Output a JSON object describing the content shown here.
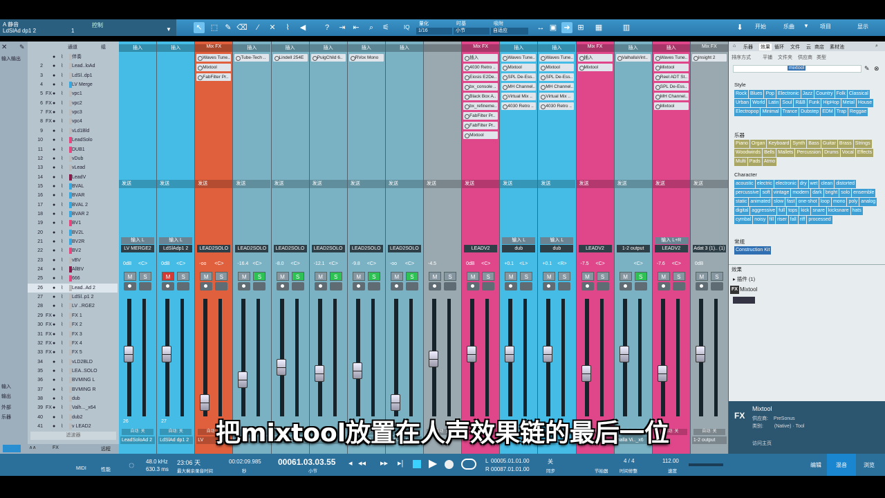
{
  "topbar": {
    "song_label": "静音",
    "track_name": "LdSlAd dp1 2",
    "ctrl_label": "控制",
    "icon_a": "A",
    "counter": "1",
    "quant_label": "量化",
    "quant_value": "1/16",
    "timebase_label": "时基",
    "timebase_value": "小节",
    "snap_label": "吸附",
    "snap_value": "自适应",
    "iq": "IQ",
    "nav": [
      "开始",
      "乐曲",
      "项目",
      "显示"
    ]
  },
  "tracklist": {
    "header_ch": "通道",
    "header_grp": "组",
    "input_menu": "输入输出",
    "side_labels": [
      "输入",
      "输出",
      "外部",
      "乐器"
    ],
    "rows": [
      {
        "n": "",
        "f": "",
        "nm": "伴奏",
        "c": "#bbb"
      },
      {
        "n": "2",
        "f": "",
        "nm": "Lead..loAd",
        "c": "#bbb"
      },
      {
        "n": "3",
        "f": "",
        "nm": "LdSl..dp1",
        "c": "#bbb"
      },
      {
        "n": "4",
        "f": "",
        "nm": "LV Merge",
        "c": "#35a9e0"
      },
      {
        "n": "5",
        "f": "FX",
        "nm": "vpc1",
        "c": "#bbb"
      },
      {
        "n": "6",
        "f": "FX",
        "nm": "vpc2",
        "c": "#bbb"
      },
      {
        "n": "7",
        "f": "FX",
        "nm": "vpc3",
        "c": "#bbb"
      },
      {
        "n": "8",
        "f": "FX",
        "nm": "vpc4",
        "c": "#bbb"
      },
      {
        "n": "9",
        "f": "",
        "nm": "vLd1Bld",
        "c": "#bbb"
      },
      {
        "n": "10",
        "f": "",
        "nm": "LeadSolo",
        "c": "#e8467e"
      },
      {
        "n": "11",
        "f": "",
        "nm": "DUB1",
        "c": "#e8467e"
      },
      {
        "n": "12",
        "f": "",
        "nm": "vDub",
        "c": "#bbb"
      },
      {
        "n": "13",
        "f": "",
        "nm": "vLead",
        "c": "#bbb"
      },
      {
        "n": "14",
        "f": "",
        "nm": "LeadV",
        "c": "#8a1a4a"
      },
      {
        "n": "15",
        "f": "",
        "nm": "BVAL",
        "c": "#35a9e0"
      },
      {
        "n": "16",
        "f": "",
        "nm": "BVAR",
        "c": "#35a9e0"
      },
      {
        "n": "17",
        "f": "",
        "nm": "BVAL 2",
        "c": "#35a9e0"
      },
      {
        "n": "18",
        "f": "",
        "nm": "BVAR 2",
        "c": "#35a9e0"
      },
      {
        "n": "19",
        "f": "",
        "nm": "BV1",
        "c": "#e8467e"
      },
      {
        "n": "20",
        "f": "",
        "nm": "BV2L",
        "c": "#35a9e0"
      },
      {
        "n": "21",
        "f": "",
        "nm": "BV2R",
        "c": "#35a9e0"
      },
      {
        "n": "22",
        "f": "",
        "nm": "BV2",
        "c": "#e8467e"
      },
      {
        "n": "23",
        "f": "",
        "nm": "vBV",
        "c": "#bbb"
      },
      {
        "n": "24",
        "f": "",
        "nm": "AllBV",
        "c": "#8a1a4a"
      },
      {
        "n": "25",
        "f": "",
        "nm": "666",
        "c": "#e8467e"
      },
      {
        "n": "26",
        "f": "",
        "nm": "Lead..Ad 2",
        "c": "#bbb"
      },
      {
        "n": "27",
        "f": "",
        "nm": "LdSl..p1 2",
        "c": "#bbb"
      },
      {
        "n": "28",
        "f": "",
        "nm": "LV ..RGE2",
        "c": "#bbb"
      },
      {
        "n": "29",
        "f": "FX",
        "nm": "FX 1",
        "c": "#bbb"
      },
      {
        "n": "30",
        "f": "FX",
        "nm": "FX 2",
        "c": "#bbb"
      },
      {
        "n": "31",
        "f": "FX",
        "nm": "FX 3",
        "c": "#bbb"
      },
      {
        "n": "32",
        "f": "FX",
        "nm": "FX 4",
        "c": "#bbb"
      },
      {
        "n": "33",
        "f": "FX",
        "nm": "FX 5",
        "c": "#bbb"
      },
      {
        "n": "34",
        "f": "",
        "nm": "vLD2BLD",
        "c": "#bbb"
      },
      {
        "n": "35",
        "f": "",
        "nm": "LEA..SOLO",
        "c": "#bbb"
      },
      {
        "n": "36",
        "f": "",
        "nm": "BVMING L",
        "c": "#bbb"
      },
      {
        "n": "37",
        "f": "",
        "nm": "BVMING R",
        "c": "#bbb"
      },
      {
        "n": "38",
        "f": "",
        "nm": "dub",
        "c": "#bbb"
      },
      {
        "n": "39",
        "f": "FX",
        "nm": "Valh..._x64",
        "c": "#bbb"
      },
      {
        "n": "40",
        "f": "",
        "nm": "dub2",
        "c": "#bbb"
      },
      {
        "n": "41",
        "f": "",
        "nm": "v LEAD2",
        "c": "#bbb"
      }
    ],
    "filter_label": "滤波器"
  },
  "mixer": {
    "insert_label": "插入",
    "send_label": "发送",
    "auto_label": "自动: 关",
    "strips": [
      {
        "hdr": "插入",
        "bg": "#44bce6",
        "ins": [],
        "inp": "输入 L",
        "ch": "LV MERGE2",
        "vol": "0dB",
        "pan": "<C>",
        "solo": false,
        "mute": false,
        "num": "26",
        "bottom": "LeadSoloAd 2",
        "fader": 0.55
      },
      {
        "hdr": "插入",
        "bg": "#44bce6",
        "ins": [],
        "inp": "输入 L",
        "ch": "LdSlAdp1 2",
        "vol": "0dB",
        "pan": "<C>",
        "solo": false,
        "mute": true,
        "num": "27",
        "bottom": "LdSlAd dp1 2",
        "fader": 0.55
      },
      {
        "hdr": "Mix FX",
        "bg": "#e0603d",
        "ins": [
          "Waves Tune..",
          "Mixtool",
          "FabFilter Pr.."
        ],
        "inp": "",
        "ch": "LEAD2SOLO",
        "vol": "-oo",
        "pan": "<C>",
        "solo": false,
        "mute": false,
        "num": "",
        "bottom": "LV",
        "fader": 0.08
      },
      {
        "hdr": "插入",
        "bg": "#7ab2c4",
        "ins": [
          "Tube-Tech .."
        ],
        "inp": "",
        "ch": "LEAD2SOLO",
        "vol": "-16.4",
        "pan": "<C>",
        "solo": true,
        "mute": false,
        "num": "",
        "bottom": "vLD2BLD",
        "fader": 0.3
      },
      {
        "hdr": "插入",
        "bg": "#7ab2c4",
        "ins": [
          "Lindell 254E"
        ],
        "inp": "",
        "ch": "LEAD2SOLO",
        "vol": "-8.0",
        "pan": "<C>",
        "solo": true,
        "mute": false,
        "num": "",
        "bottom": "vLD2BLD",
        "fader": 0.42
      },
      {
        "hdr": "插入",
        "bg": "#7ab2c4",
        "ins": [
          "PuigChild 6.."
        ],
        "inp": "",
        "ch": "LEAD2SOLO",
        "vol": "-12.1",
        "pan": "<C>",
        "solo": true,
        "mute": false,
        "num": "",
        "bottom": "vLD2BLD",
        "fader": 0.36
      },
      {
        "hdr": "插入",
        "bg": "#7ab2c4",
        "ins": [
          "RVox Mono"
        ],
        "inp": "",
        "ch": "LEAD2SOLO",
        "vol": "-9.8",
        "pan": "<C>",
        "solo": true,
        "mute": false,
        "num": "",
        "bottom": "vLD2BLD",
        "fader": 0.39
      },
      {
        "hdr": "插入",
        "bg": "#7ab2c4",
        "ins": [],
        "inp": "",
        "ch": "LEAD2SOLO",
        "vol": "-oo",
        "pan": "<C>",
        "solo": true,
        "mute": false,
        "num": "",
        "bottom": "vLD2BLD",
        "fader": 0.08
      },
      {
        "hdr": "",
        "bg": "#9aa8b0",
        "ins": [],
        "inp": "",
        "ch": "",
        "vol": "-4.5",
        "pan": "",
        "solo": false,
        "mute": false,
        "num": "",
        "bottom": "",
        "fader": 0.5
      },
      {
        "hdr": "Mix FX",
        "bg": "#e0478a",
        "ins": [
          "插入",
          "4030 Retro ..",
          "Eiosis E2De..",
          "bx_console ..",
          "Black Box A..",
          "bx_refineme..",
          "FabFilter Pr..",
          "FabFilter Pr..",
          "Mixtool"
        ],
        "inp": "",
        "ch": "LEADV2",
        "vol": "0dB",
        "pan": "<C>",
        "solo": false,
        "mute": false,
        "num": "",
        "bottom": "",
        "fader": 0.55
      },
      {
        "hdr": "插入",
        "bg": "#44bce6",
        "ins": [
          "Waves Tune..",
          "Mixtool",
          "SPL De-Ess..",
          "MH Channel..",
          "Virtual Mix ..",
          "4030 Retro .."
        ],
        "inp": "输入 L",
        "ch": "dub",
        "vol": "+0.1",
        "pan": "<L>",
        "solo": false,
        "mute": false,
        "num": "",
        "bottom": "",
        "fader": 0.55
      },
      {
        "hdr": "插入",
        "bg": "#44bce6",
        "ins": [
          "Waves Tune..",
          "Mixtool",
          "SPL De-Ess..",
          "MH Channel..",
          "Virtual Mix ..",
          "4030 Retro .."
        ],
        "inp": "输入 L",
        "ch": "dub",
        "vol": "+0.1",
        "pan": "<R>",
        "solo": false,
        "mute": false,
        "num": "",
        "bottom": "",
        "fader": 0.55
      },
      {
        "hdr": "Mix FX",
        "bg": "#e0478a",
        "ins": [
          "插入",
          "Mixtool"
        ],
        "inp": "",
        "ch": "LEADV2",
        "vol": "-7.5",
        "pan": "<C>",
        "solo": false,
        "mute": false,
        "num": "",
        "bottom": "",
        "fader": 0.36
      },
      {
        "hdr": "插入",
        "bg": "#7ab2c4",
        "ins": [
          "ValhallaVint.."
        ],
        "inp": "",
        "ch": "1-2 output",
        "vol": "",
        "pan": "<C>",
        "solo": true,
        "mute": false,
        "num": "",
        "bottom": "halla Vi.._x6",
        "fader": 0.55
      },
      {
        "hdr": "插入",
        "bg": "#e0478a",
        "ins": [
          "Waves Tune..",
          "Mixtool",
          "Reel ADT St..",
          "SPL De-Ess..",
          "MH Channel..",
          "Mixtool"
        ],
        "inp": "输入 L+R",
        "ch": "LEADV2",
        "vol": "-7.6",
        "pan": "<C>",
        "solo": false,
        "mute": false,
        "num": "",
        "bottom": "",
        "fader": 0.36
      },
      {
        "hdr": "Mix FX",
        "bg": "#9aa8b0",
        "ins": [
          "Insight 2"
        ],
        "inp": "",
        "ch": "Adat 3 (1).. (1)",
        "vol": "0dB",
        "pan": "",
        "solo": false,
        "mute": false,
        "num": "",
        "bottom": "1-2 output",
        "fader": 0.55
      }
    ]
  },
  "browser": {
    "tabs": [
      "乐器",
      "效果",
      "循环",
      "文件",
      "云",
      "商店",
      "素材池"
    ],
    "sort_label": "排序方式",
    "sort_opts": [
      "平铺",
      "文件夹",
      "供应商",
      "类型"
    ],
    "search": "mixtool",
    "style_label": "Style",
    "style_tags": [
      "Rock",
      "Blues",
      "Pop",
      "Electronic",
      "Jazz",
      "Country",
      "Folk",
      "Classical",
      "Urban",
      "World",
      "Latin",
      "Soul",
      "R&B",
      "Funk",
      "HipHop",
      "Metal",
      "House",
      "Electropop",
      "Minimal",
      "Trance",
      "Dubstep",
      "EDM",
      "Trap",
      "Reggae"
    ],
    "inst_label": "乐器",
    "inst_tags": [
      "Piano",
      "Organ",
      "Keyboard",
      "Synth",
      "Bass",
      "Guitar",
      "Brass",
      "Strings",
      "Woodwinds",
      "Bells",
      "Mallets",
      "Percussion",
      "Drums",
      "Vocal",
      "Effects",
      "Multi",
      "Pads",
      "Atmo"
    ],
    "char_label": "Character",
    "char_tags": [
      "acoustic",
      "electric",
      "electronic",
      "dry",
      "wet",
      "clean",
      "distorted",
      "percussive",
      "soft",
      "vintage",
      "modern",
      "dark",
      "bright",
      "solo",
      "ensemble",
      "static",
      "animated",
      "slow",
      "fast",
      "one-shot",
      "loop",
      "mono",
      "poly",
      "analog",
      "digital",
      "aggressive",
      "full",
      "tops",
      "kick",
      "snare",
      "kicksnare",
      "hats",
      "cymbal",
      "noisy",
      "fill",
      "riser",
      "fall",
      "riff",
      "processed"
    ],
    "common_label": "常规",
    "common_tags": [
      "Construction Kit"
    ],
    "effects_label": "效果",
    "plugins_label": "插件 (1)",
    "plugin_name": "Mixtool",
    "detail_name": "Mixtool",
    "vendor_label": "供应商:",
    "vendor": "PreSonus",
    "type_label": "类别:",
    "type": "(Native) · Tool",
    "homepage": "访问主页",
    "fx_badge": "FX"
  },
  "bottombar": {
    "midi": "MIDI",
    "perf": "性能",
    "sample_rate": "48.0 kHz",
    "latency": "630.3 ms",
    "rec_time": "23:06 天",
    "rec_caption": "最大剩余录音时间",
    "time1": "00:02:09.985",
    "time1_unit": "秒",
    "position": "00061.03.03.55",
    "position_unit": "小节",
    "loop_l": "00005.01.01.00",
    "loop_r": "00087.01.01.00",
    "sync": "关",
    "sync_label": "同步",
    "metronome": "节拍器",
    "sig": "4 / 4",
    "sig_label": "时间修整",
    "tempo": "112.00",
    "tempo_label": "速度",
    "views": [
      "编辑",
      "混音",
      "浏览"
    ],
    "lbl_L": "L",
    "lbl_R": "R"
  },
  "subtitle": "把mixtool放置在人声效果链的最后一位",
  "colors": {
    "blue": "#44bce6",
    "pink": "#e0478a",
    "orange": "#e0603d",
    "green": "#2ec255"
  }
}
